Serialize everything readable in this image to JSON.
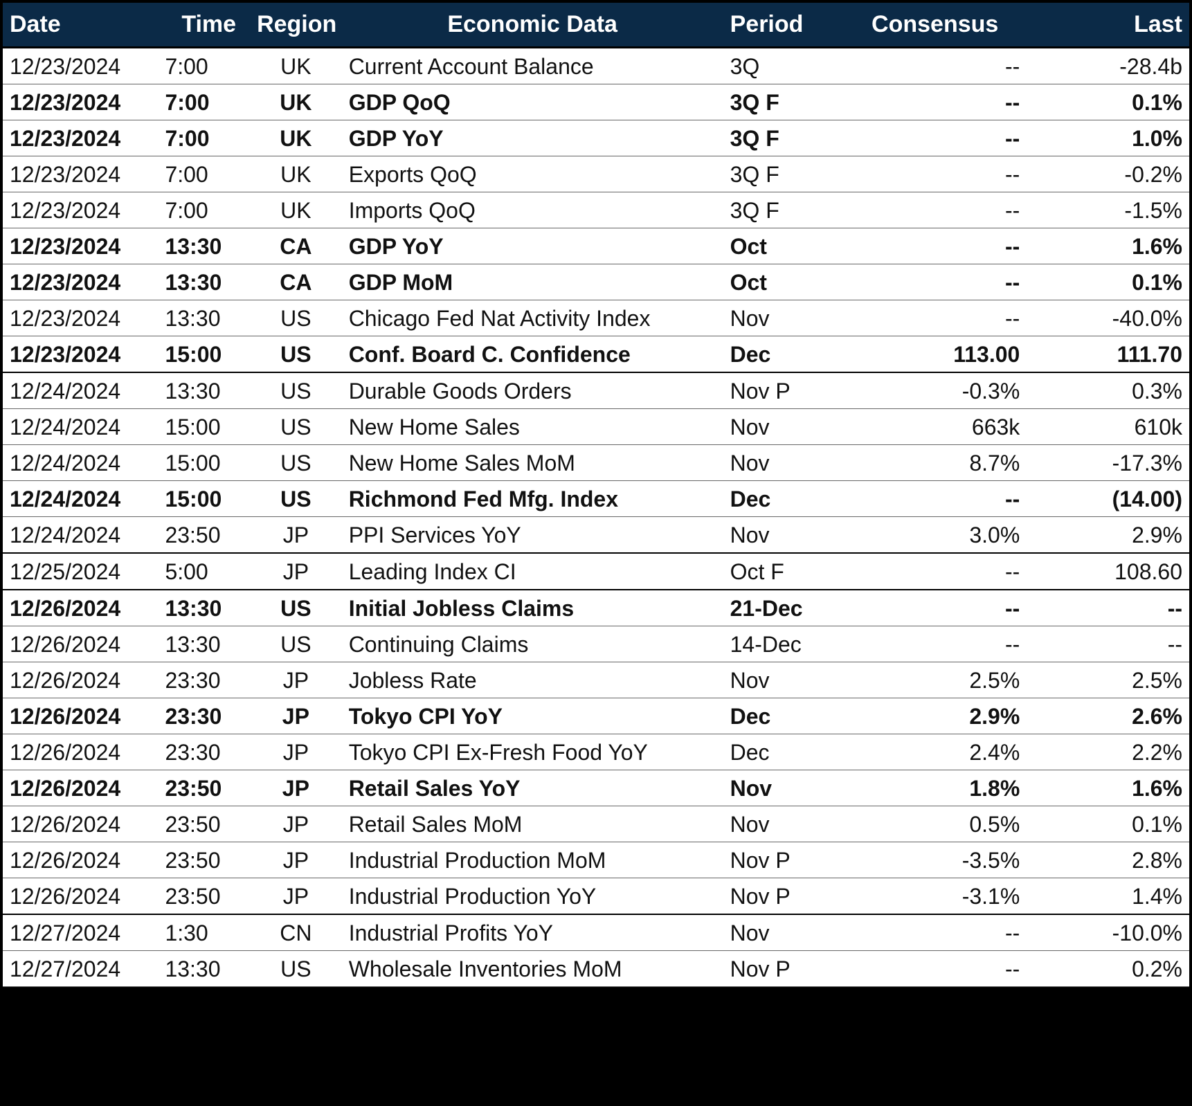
{
  "headers": {
    "date": "Date",
    "time": "Time",
    "region": "Region",
    "data": "Economic Data",
    "period": "Period",
    "consensus": "Consensus",
    "last": "Last"
  },
  "rows": [
    {
      "date": "12/23/2024",
      "time": "7:00",
      "region": "UK",
      "data": "Current Account Balance",
      "period": "3Q",
      "consensus": "--",
      "last": "-28.4b",
      "bold": false,
      "day_end": false
    },
    {
      "date": "12/23/2024",
      "time": "7:00",
      "region": "UK",
      "data": "GDP QoQ",
      "period": "3Q F",
      "consensus": "--",
      "last": "0.1%",
      "bold": true,
      "day_end": false
    },
    {
      "date": "12/23/2024",
      "time": "7:00",
      "region": "UK",
      "data": "GDP YoY",
      "period": "3Q F",
      "consensus": "--",
      "last": "1.0%",
      "bold": true,
      "day_end": false
    },
    {
      "date": "12/23/2024",
      "time": "7:00",
      "region": "UK",
      "data": "Exports QoQ",
      "period": "3Q F",
      "consensus": "--",
      "last": "-0.2%",
      "bold": false,
      "day_end": false
    },
    {
      "date": "12/23/2024",
      "time": "7:00",
      "region": "UK",
      "data": "Imports QoQ",
      "period": "3Q F",
      "consensus": "--",
      "last": "-1.5%",
      "bold": false,
      "day_end": false
    },
    {
      "date": "12/23/2024",
      "time": "13:30",
      "region": "CA",
      "data": "GDP YoY",
      "period": "Oct",
      "consensus": "--",
      "last": "1.6%",
      "bold": true,
      "day_end": false
    },
    {
      "date": "12/23/2024",
      "time": "13:30",
      "region": "CA",
      "data": "GDP MoM",
      "period": "Oct",
      "consensus": "--",
      "last": "0.1%",
      "bold": true,
      "day_end": false
    },
    {
      "date": "12/23/2024",
      "time": "13:30",
      "region": "US",
      "data": "Chicago Fed Nat Activity Index",
      "period": "Nov",
      "consensus": "--",
      "last": "-40.0%",
      "bold": false,
      "day_end": false
    },
    {
      "date": "12/23/2024",
      "time": "15:00",
      "region": "US",
      "data": "Conf. Board C. Confidence",
      "period": "Dec",
      "consensus": "113.00",
      "last": "111.70",
      "bold": true,
      "day_end": true
    },
    {
      "date": "12/24/2024",
      "time": "13:30",
      "region": "US",
      "data": "Durable Goods Orders",
      "period": "Nov P",
      "consensus": "-0.3%",
      "last": "0.3%",
      "bold": false,
      "day_end": false
    },
    {
      "date": "12/24/2024",
      "time": "15:00",
      "region": "US",
      "data": "New Home Sales",
      "period": "Nov",
      "consensus": "663k",
      "last": "610k",
      "bold": false,
      "day_end": false
    },
    {
      "date": "12/24/2024",
      "time": "15:00",
      "region": "US",
      "data": "New Home Sales MoM",
      "period": "Nov",
      "consensus": "8.7%",
      "last": "-17.3%",
      "bold": false,
      "day_end": false
    },
    {
      "date": "12/24/2024",
      "time": "15:00",
      "region": "US",
      "data": "Richmond Fed Mfg. Index",
      "period": "Dec",
      "consensus": "--",
      "last": "(14.00)",
      "bold": true,
      "day_end": false
    },
    {
      "date": "12/24/2024",
      "time": "23:50",
      "region": "JP",
      "data": "PPI Services YoY",
      "period": "Nov",
      "consensus": "3.0%",
      "last": "2.9%",
      "bold": false,
      "day_end": true
    },
    {
      "date": "12/25/2024",
      "time": "5:00",
      "region": "JP",
      "data": "Leading Index CI",
      "period": "Oct F",
      "consensus": "--",
      "last": "108.60",
      "bold": false,
      "day_end": true
    },
    {
      "date": "12/26/2024",
      "time": "13:30",
      "region": "US",
      "data": "Initial Jobless Claims",
      "period": "21-Dec",
      "consensus": "--",
      "last": "--",
      "bold": true,
      "day_end": false
    },
    {
      "date": "12/26/2024",
      "time": "13:30",
      "region": "US",
      "data": "Continuing Claims",
      "period": "14-Dec",
      "consensus": "--",
      "last": "--",
      "bold": false,
      "day_end": false
    },
    {
      "date": "12/26/2024",
      "time": "23:30",
      "region": "JP",
      "data": "Jobless Rate",
      "period": "Nov",
      "consensus": "2.5%",
      "last": "2.5%",
      "bold": false,
      "day_end": false
    },
    {
      "date": "12/26/2024",
      "time": "23:30",
      "region": "JP",
      "data": "Tokyo CPI YoY",
      "period": "Dec",
      "consensus": "2.9%",
      "last": "2.6%",
      "bold": true,
      "day_end": false
    },
    {
      "date": "12/26/2024",
      "time": "23:30",
      "region": "JP",
      "data": "Tokyo CPI Ex-Fresh Food YoY",
      "period": "Dec",
      "consensus": "2.4%",
      "last": "2.2%",
      "bold": false,
      "day_end": false
    },
    {
      "date": "12/26/2024",
      "time": "23:50",
      "region": "JP",
      "data": "Retail Sales YoY",
      "period": "Nov",
      "consensus": "1.8%",
      "last": "1.6%",
      "bold": true,
      "day_end": false
    },
    {
      "date": "12/26/2024",
      "time": "23:50",
      "region": "JP",
      "data": "Retail Sales MoM",
      "period": "Nov",
      "consensus": "0.5%",
      "last": "0.1%",
      "bold": false,
      "day_end": false
    },
    {
      "date": "12/26/2024",
      "time": "23:50",
      "region": "JP",
      "data": "Industrial Production MoM",
      "period": "Nov P",
      "consensus": "-3.5%",
      "last": "2.8%",
      "bold": false,
      "day_end": false
    },
    {
      "date": "12/26/2024",
      "time": "23:50",
      "region": "JP",
      "data": "Industrial Production YoY",
      "period": "Nov P",
      "consensus": "-3.1%",
      "last": "1.4%",
      "bold": false,
      "day_end": true
    },
    {
      "date": "12/27/2024",
      "time": "1:30",
      "region": "CN",
      "data": "Industrial Profits YoY",
      "period": "Nov",
      "consensus": "--",
      "last": "-10.0%",
      "bold": false,
      "day_end": false
    },
    {
      "date": "12/27/2024",
      "time": "13:30",
      "region": "US",
      "data": "Wholesale Inventories MoM",
      "period": "Nov P",
      "consensus": "--",
      "last": "0.2%",
      "bold": false,
      "day_end": false
    }
  ]
}
